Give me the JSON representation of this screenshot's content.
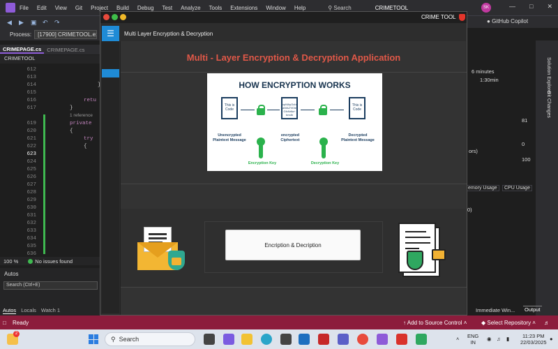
{
  "vs": {
    "menu": [
      "File",
      "Edit",
      "View",
      "Git",
      "Project",
      "Build",
      "Debug",
      "Test",
      "Analyze",
      "Tools",
      "Extensions",
      "Window",
      "Help"
    ],
    "search_label": "Search",
    "solution_title": "CRIMETOOL",
    "avatar_initials": "SK",
    "copilot_label": "GitHub Copilot",
    "process_label": "Process:",
    "process_value": "[17900] CRIMETOOL.exe",
    "tabs": [
      {
        "label": "CRIMEPAGE.cs",
        "active": true
      },
      {
        "label": "CRIMEPAGE.cs",
        "active": false
      }
    ],
    "file_selector": "CRIMETOOL",
    "code_lines": [
      {
        "ln": "612",
        "code": ""
      },
      {
        "ln": "613",
        "code": ""
      },
      {
        "ln": "614",
        "code": "}"
      },
      {
        "ln": "615",
        "code": ""
      },
      {
        "ln": "616",
        "code": "retu"
      },
      {
        "ln": "617",
        "code": "}"
      },
      {
        "ln": "",
        "code": "1 reference"
      },
      {
        "ln": "619",
        "code": "private"
      },
      {
        "ln": "620",
        "code": "{"
      },
      {
        "ln": "621",
        "code": "try"
      },
      {
        "ln": "622",
        "code": "{"
      },
      {
        "ln": "623",
        "code": ""
      },
      {
        "ln": "624",
        "code": ""
      },
      {
        "ln": "625",
        "code": ""
      },
      {
        "ln": "626",
        "code": ""
      },
      {
        "ln": "627",
        "code": ""
      },
      {
        "ln": "628",
        "code": ""
      },
      {
        "ln": "629",
        "code": ""
      },
      {
        "ln": "630",
        "code": ""
      },
      {
        "ln": "631",
        "code": ""
      },
      {
        "ln": "632",
        "code": ""
      },
      {
        "ln": "633",
        "code": ""
      },
      {
        "ln": "634",
        "code": ""
      },
      {
        "ln": "635",
        "code": ""
      },
      {
        "ln": "636",
        "code": ""
      }
    ],
    "zoom": "100 %",
    "issues_label": "No issues found",
    "autos_title": "Autos",
    "autos_search": "Search (Ctrl+E)",
    "autos_tabs": [
      "Autos",
      "Locals",
      "Watch 1"
    ],
    "right_panel": {
      "time1": "6 minutes",
      "time2": "1:30min",
      "val81": "81",
      "val0": "0",
      "ors": "ors)",
      "val100": "100",
      "memory_tab": "emory Usage",
      "cpu_tab": "CPU Usage",
      "zero_paren": "0)",
      "immediate_tab": "Immediate Win...",
      "output_tab": "Output",
      "solution_explorer": "Solution Explorer",
      "git_changes": "Git Changes"
    },
    "status": {
      "ready": "Ready",
      "source_control": "Add to Source Control",
      "select_repo": "Select Repository"
    }
  },
  "taskbar": {
    "search_placeholder": "Search",
    "lang": "ENG",
    "region": "IN",
    "time": "11:23 PM",
    "date": "22/03/2025",
    "badge": "2"
  },
  "crime_tool": {
    "title": "CRIME TOOL",
    "header": "Multi Layer Encryption & Decryption",
    "heading": "Multi - Layer Encryption & Decryption Application",
    "infographic": {
      "title": "HOW ENCRYPTION WORKS",
      "doc1": "This is Code",
      "doc2": "xpMAyOcIx aWAZYi0Ie GfxNrtla+ bmdb",
      "doc3": "This is Code",
      "label1": "Unencrypted Plaintext Message",
      "label2": "encrypted Ciphertext",
      "label3": "Decrypted Plaintext Message",
      "key1": "Encryption Key",
      "key2": "Decryption Key"
    },
    "button_label": "Encription & Decription"
  }
}
